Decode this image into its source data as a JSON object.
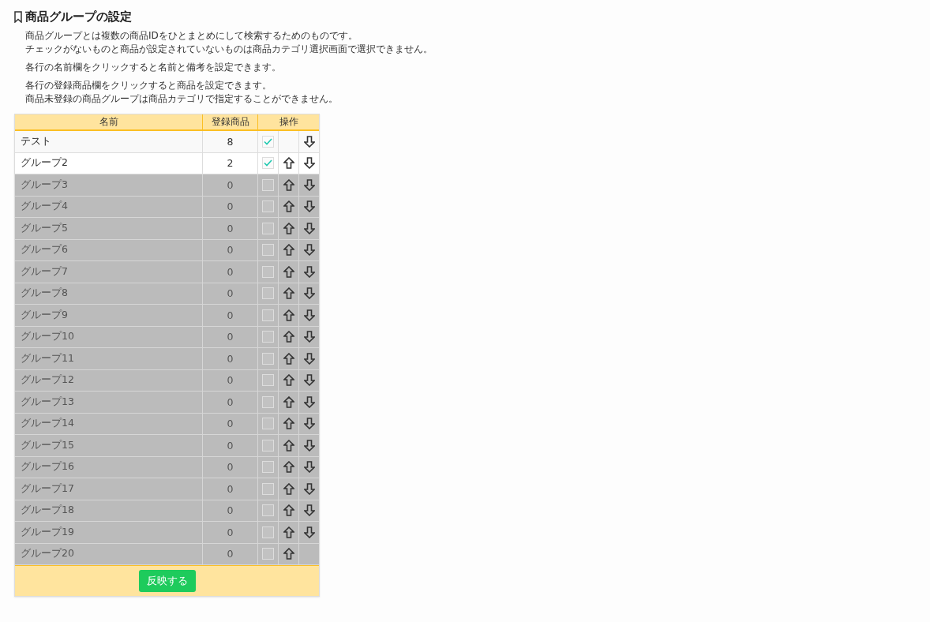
{
  "title": "商品グループの設定",
  "notes": [
    [
      "商品グループとは複数の商品IDをひとまとめにして検索するためのものです。",
      "チェックがないものと商品が設定されていないものは商品カテゴリ選択画面で選択できません。"
    ],
    [
      "各行の名前欄をクリックすると名前と備考を設定できます。"
    ],
    [
      "各行の登録商品欄をクリックすると商品を設定できます。",
      "商品未登録の商品グループは商品カテゴリで指定することができません。"
    ]
  ],
  "table": {
    "columns": [
      "名前",
      "登録商品",
      "操作"
    ],
    "rows": [
      {
        "name": "テスト",
        "count": "8",
        "checked": true
      },
      {
        "name": "グループ2",
        "count": "2",
        "checked": true
      },
      {
        "name": "グループ3",
        "count": "0",
        "checked": false
      },
      {
        "name": "グループ4",
        "count": "0",
        "checked": false
      },
      {
        "name": "グループ5",
        "count": "0",
        "checked": false
      },
      {
        "name": "グループ6",
        "count": "0",
        "checked": false
      },
      {
        "name": "グループ7",
        "count": "0",
        "checked": false
      },
      {
        "name": "グループ8",
        "count": "0",
        "checked": false
      },
      {
        "name": "グループ9",
        "count": "0",
        "checked": false
      },
      {
        "name": "グループ10",
        "count": "0",
        "checked": false
      },
      {
        "name": "グループ11",
        "count": "0",
        "checked": false
      },
      {
        "name": "グループ12",
        "count": "0",
        "checked": false
      },
      {
        "name": "グループ13",
        "count": "0",
        "checked": false
      },
      {
        "name": "グループ14",
        "count": "0",
        "checked": false
      },
      {
        "name": "グループ15",
        "count": "0",
        "checked": false
      },
      {
        "name": "グループ16",
        "count": "0",
        "checked": false
      },
      {
        "name": "グループ17",
        "count": "0",
        "checked": false
      },
      {
        "name": "グループ18",
        "count": "0",
        "checked": false
      },
      {
        "name": "グループ19",
        "count": "0",
        "checked": false
      },
      {
        "name": "グループ20",
        "count": "0",
        "checked": false
      }
    ]
  },
  "apply_button": "反映する"
}
